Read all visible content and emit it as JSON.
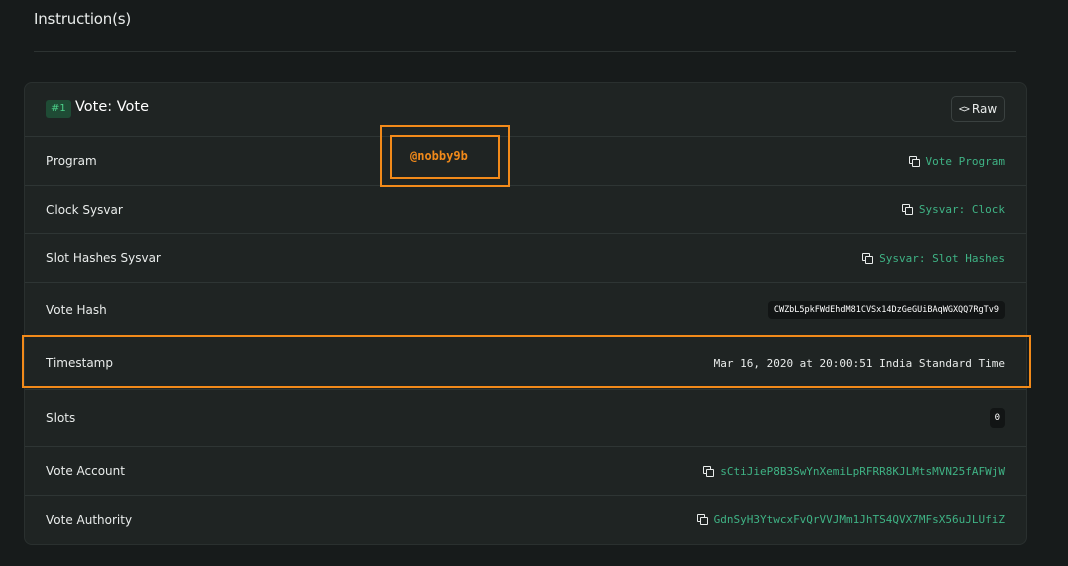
{
  "section": {
    "title": "Instruction(s)"
  },
  "instruction": {
    "index_badge": "#1",
    "title": "Vote: Vote",
    "raw_button": {
      "icon": "code-icon",
      "label": "Raw"
    }
  },
  "rows": [
    {
      "label": "Program",
      "value": "Vote Program",
      "icon": "copy-icon",
      "style": "link"
    },
    {
      "label": "Clock Sysvar",
      "value": "Sysvar: Clock",
      "icon": "copy-icon",
      "style": "link"
    },
    {
      "label": "Slot Hashes Sysvar",
      "value": "Sysvar: Slot Hashes",
      "icon": "copy-icon",
      "style": "link"
    },
    {
      "label": "Vote Hash",
      "value": "CWZbL5pkFWdEhdM81CVSx14DzGeGUiBAqWGXQQ7RgTv9",
      "style": "chip"
    },
    {
      "label": "Timestamp",
      "value": "Mar 16, 2020 at 20:00:51 India Standard Time",
      "style": "plain"
    },
    {
      "label": "Slots",
      "value": "0",
      "style": "num"
    },
    {
      "label": "Vote Account",
      "value": "sCtiJieP8B3SwYnXemiLpRFRR8KJLMtsMVN25fAFWjW",
      "icon": "copy-icon",
      "style": "link"
    },
    {
      "label": "Vote Authority",
      "value": "GdnSyH3YtwcxFvQrVVJMm1JhTS4QVX7MFsX56uJLUfiZ",
      "icon": "copy-icon",
      "style": "link"
    }
  ],
  "watermark": {
    "text": "@nobby9b"
  },
  "colors": {
    "accent_green": "#3fb385",
    "badge_green": "#4bd18a",
    "highlight_orange": "#f28a1a",
    "background": "#171b1b",
    "card": "#1f2423"
  }
}
